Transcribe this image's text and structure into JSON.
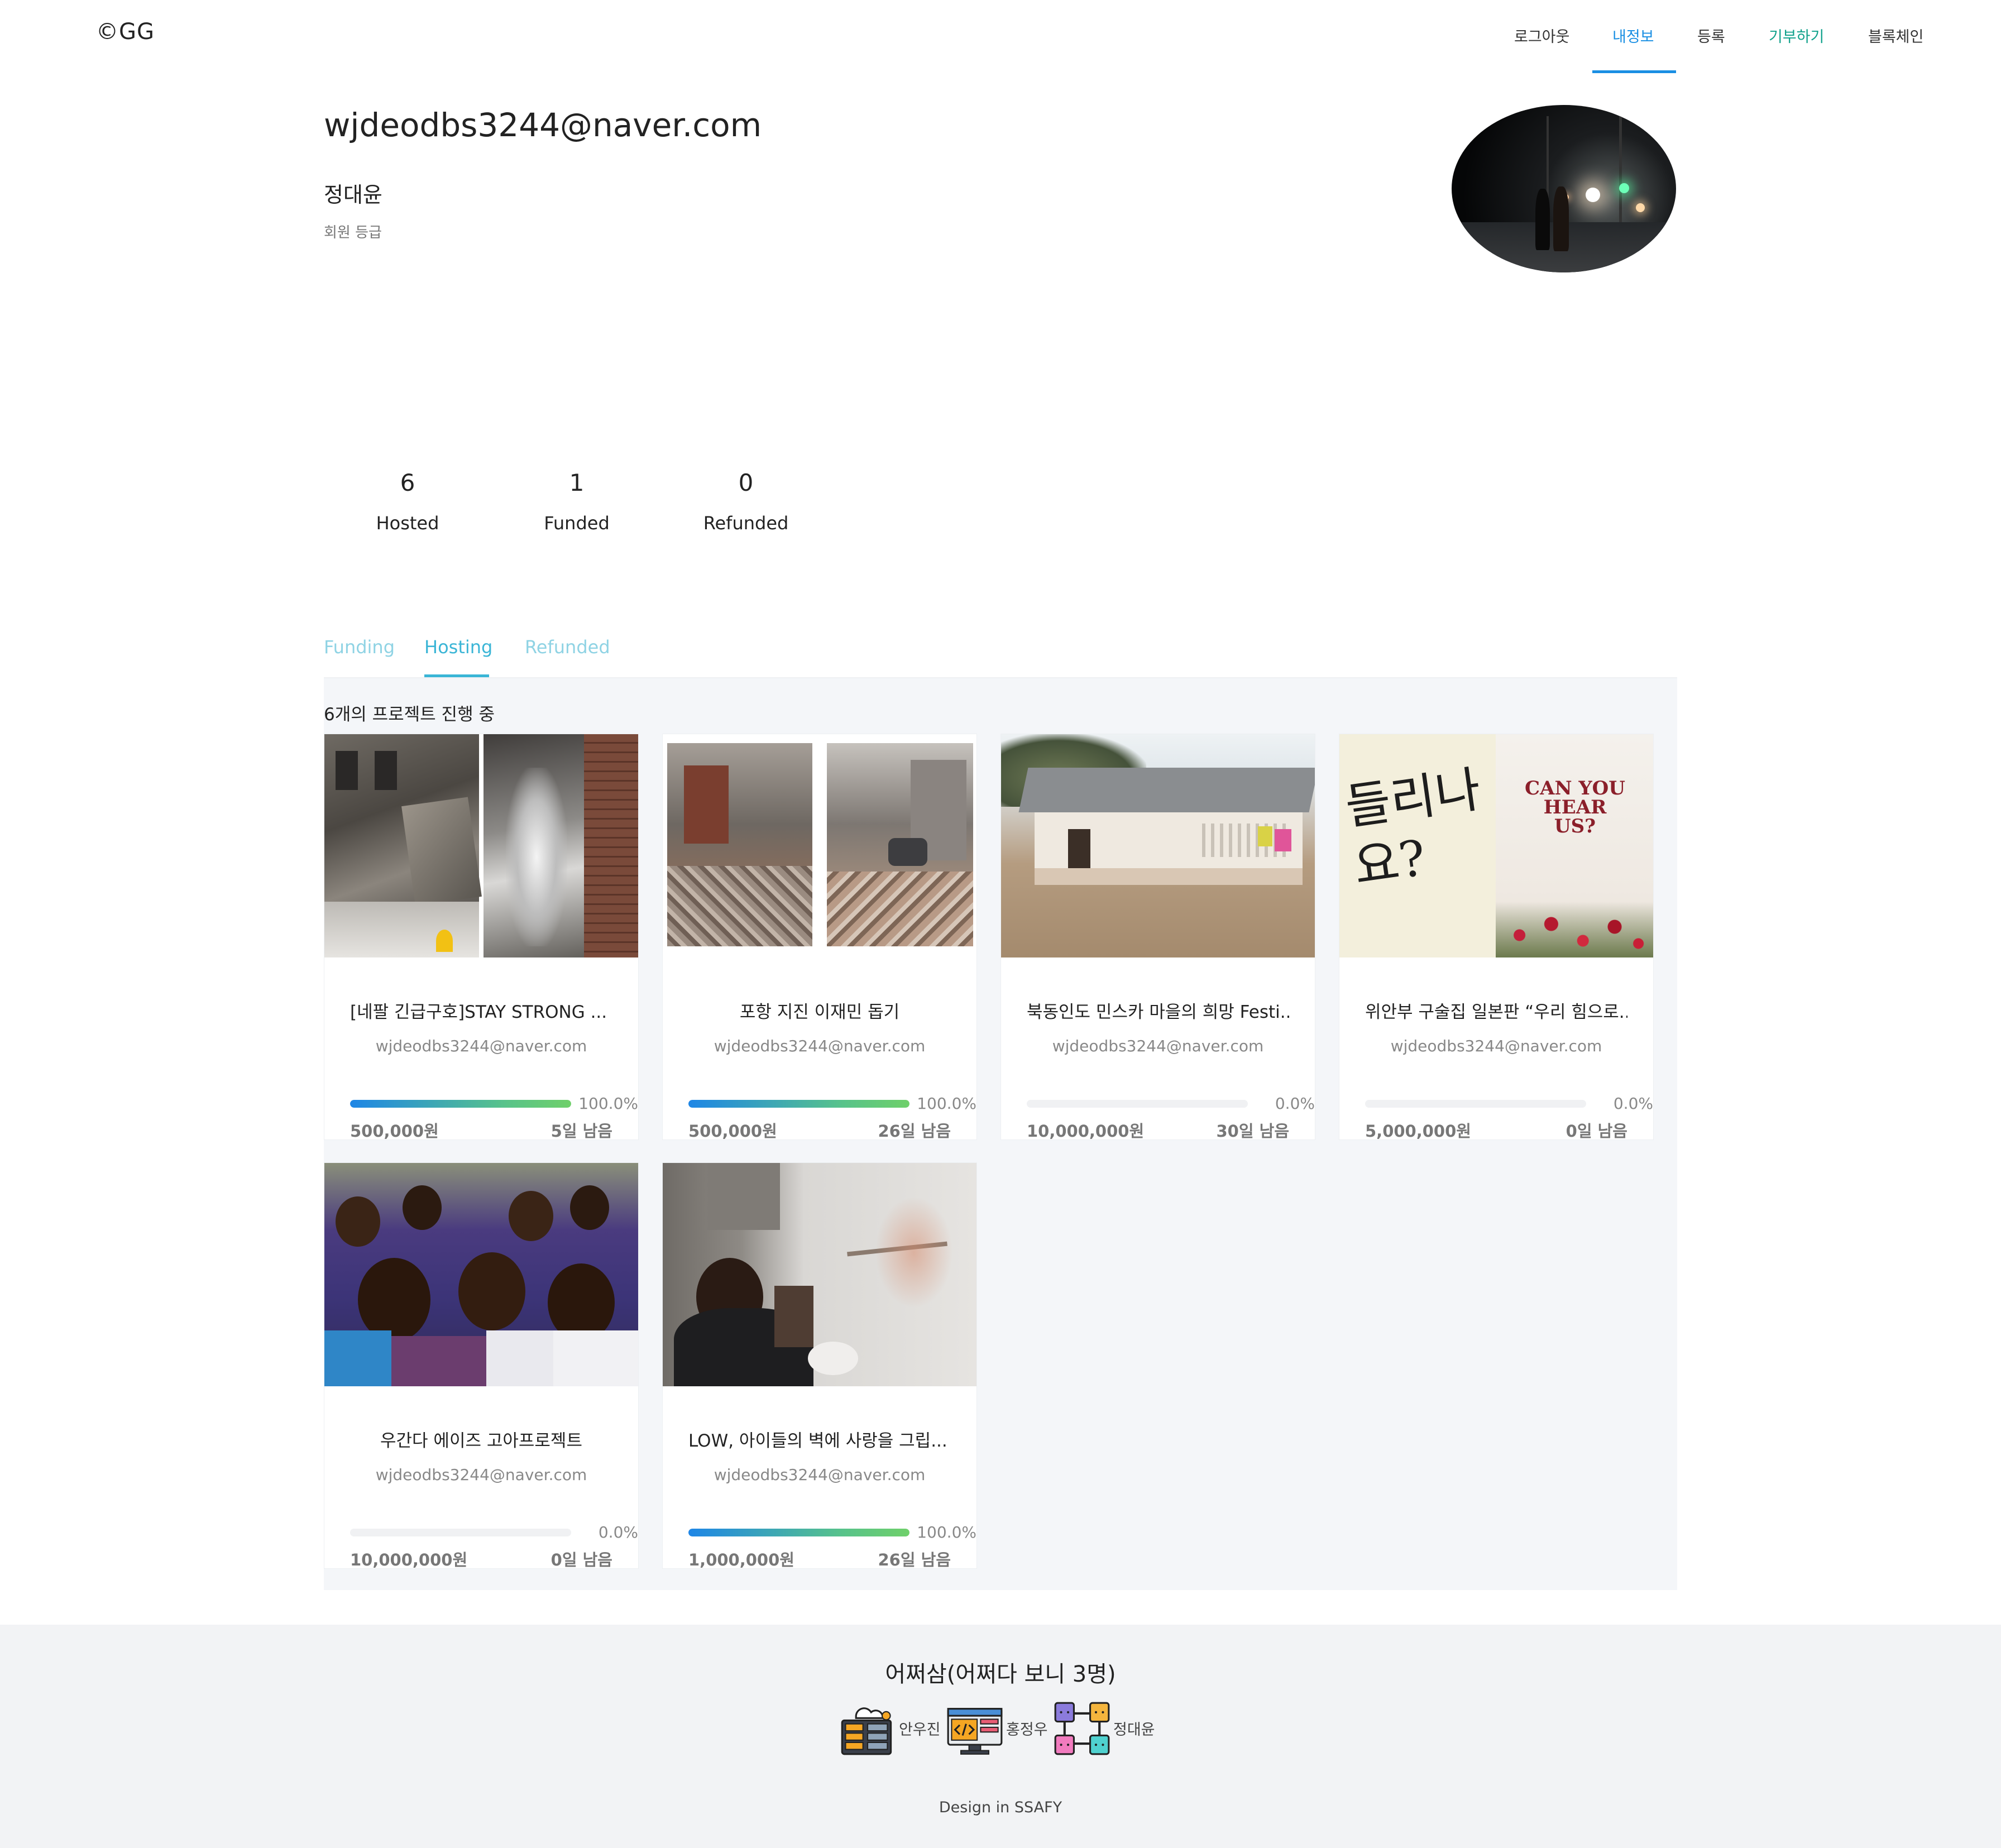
{
  "nav": {
    "logo": "©GG",
    "items": [
      {
        "label": "로그아웃"
      },
      {
        "label": "내정보"
      },
      {
        "label": "등록"
      },
      {
        "label": "기부하기"
      },
      {
        "label": "블록체인"
      }
    ],
    "active_item": "내정보"
  },
  "profile": {
    "email": "wjdeodbs3244@naver.com",
    "name": "정대윤",
    "grade_label": "회원 등급"
  },
  "stats": [
    {
      "value": "6",
      "label": "Hosted"
    },
    {
      "value": "1",
      "label": "Funded"
    },
    {
      "value": "0",
      "label": "Refunded"
    }
  ],
  "tabs": [
    {
      "label": "Funding"
    },
    {
      "label": "Hosting"
    },
    {
      "label": "Refunded"
    }
  ],
  "active_tab": "Hosting",
  "projects_heading": "6개의 프로젝트 진행 중",
  "projects": [
    {
      "title": "[네팔 긴급구호]STAY STRONG ...",
      "owner": "wjdeodbs3244@naver.com",
      "progress": 100,
      "progress_label": "100.0%",
      "amount": "500,000원",
      "days_left": "5일 남음"
    },
    {
      "title": "포항 지진 이재민 돕기",
      "owner": "wjdeodbs3244@naver.com",
      "progress": 100,
      "progress_label": "100.0%",
      "amount": "500,000원",
      "days_left": "26일 남음"
    },
    {
      "title": "북동인도 민스카 마을의 희망 Festi...",
      "owner": "wjdeodbs3244@naver.com",
      "progress": 0,
      "progress_label": "0.0%",
      "amount": "10,000,000원",
      "days_left": "30일 남음"
    },
    {
      "title": "위안부 구술집 일본판 “우리 힘으로...",
      "owner": "wjdeodbs3244@naver.com",
      "progress": 0,
      "progress_label": "0.0%",
      "amount": "5,000,000원",
      "days_left": "0일 남음",
      "image_text_left": "들리나요?",
      "image_text_right": "CAN YOU HEAR US?"
    },
    {
      "title": "우간다 에이즈 고아프로젝트",
      "owner": "wjdeodbs3244@naver.com",
      "progress": 0,
      "progress_label": "0.0%",
      "amount": "10,000,000원",
      "days_left": "0일 남음"
    },
    {
      "title": "LOW, 아이들의 벽에 사랑을 그립...",
      "owner": "wjdeodbs3244@naver.com",
      "progress": 100,
      "progress_label": "100.0%",
      "amount": "1,000,000원",
      "days_left": "26일 남음"
    }
  ],
  "footer": {
    "title": "어쩌삼(어쩌다 보니 3명)",
    "members": [
      {
        "name": "안우진",
        "icon": "server-icon"
      },
      {
        "name": "홍정우",
        "icon": "code-monitor-icon"
      },
      {
        "name": "정대윤",
        "icon": "blockchain-icon"
      }
    ],
    "credit": "Design in SSAFY"
  }
}
